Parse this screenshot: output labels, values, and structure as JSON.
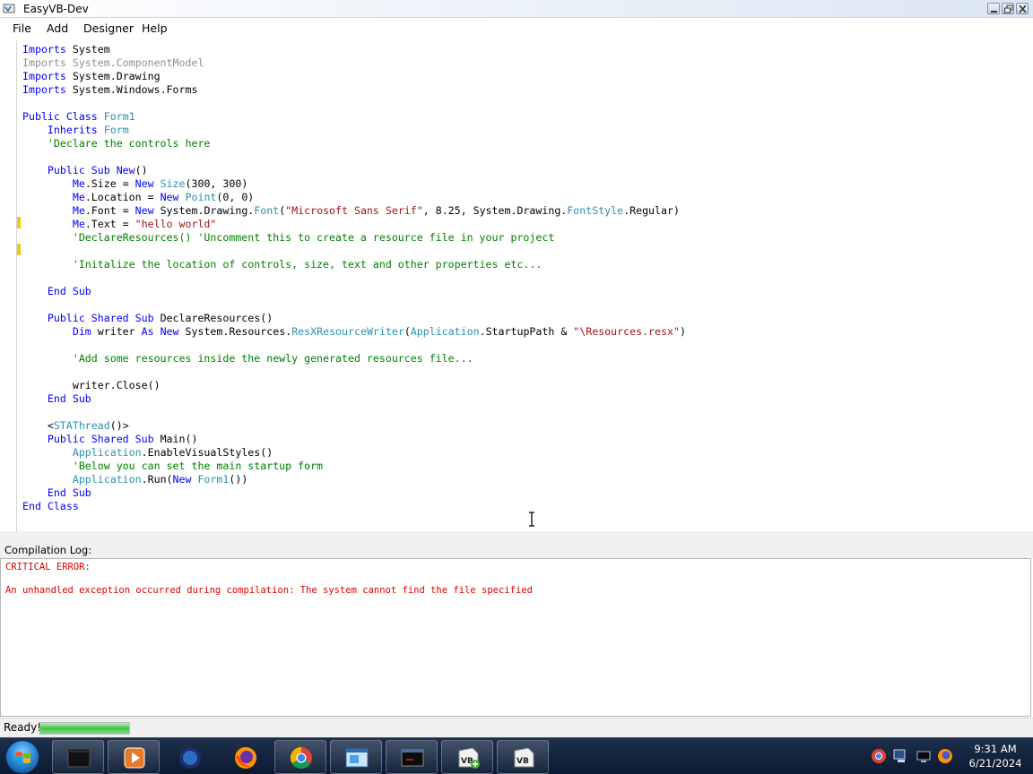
{
  "window": {
    "title": "EasyVB-Dev"
  },
  "menu": {
    "items": [
      "File",
      "Add",
      "Designer",
      "Help"
    ]
  },
  "editor": {
    "lines": [
      [
        {
          "t": "Imports",
          "c": "kw"
        },
        {
          "t": " System"
        }
      ],
      [
        {
          "t": "Imports System.ComponentModel",
          "c": "gray"
        }
      ],
      [
        {
          "t": "Imports",
          "c": "kw"
        },
        {
          "t": " System.Drawing"
        }
      ],
      [
        {
          "t": "Imports",
          "c": "kw"
        },
        {
          "t": " System.Windows.Forms"
        }
      ],
      [],
      [
        {
          "t": "Public Class ",
          "c": "kw"
        },
        {
          "t": "Form1",
          "c": "ty"
        }
      ],
      [
        {
          "t": "    Inherits ",
          "c": "kw"
        },
        {
          "t": "Form",
          "c": "ty"
        }
      ],
      [
        {
          "t": "    'Declare the controls here",
          "c": "cm"
        }
      ],
      [],
      [
        {
          "t": "    Public Sub New",
          "c": "kw"
        },
        {
          "t": "()"
        }
      ],
      [
        {
          "t": "        Me",
          "c": "kw"
        },
        {
          "t": ".Size = "
        },
        {
          "t": "New ",
          "c": "kw"
        },
        {
          "t": "Size",
          "c": "ty"
        },
        {
          "t": "(300, 300)"
        }
      ],
      [
        {
          "t": "        Me",
          "c": "kw"
        },
        {
          "t": ".Location = "
        },
        {
          "t": "New ",
          "c": "kw"
        },
        {
          "t": "Point",
          "c": "ty"
        },
        {
          "t": "(0, 0)"
        }
      ],
      [
        {
          "t": "        Me",
          "c": "kw"
        },
        {
          "t": ".Font = "
        },
        {
          "t": "New ",
          "c": "kw"
        },
        {
          "t": "System.Drawing."
        },
        {
          "t": "Font",
          "c": "ty"
        },
        {
          "t": "("
        },
        {
          "t": "\"Microsoft Sans Serif\"",
          "c": "str"
        },
        {
          "t": ", 8.25, System.Drawing."
        },
        {
          "t": "FontStyle",
          "c": "ty"
        },
        {
          "t": ".Regular)"
        }
      ],
      [
        {
          "t": "        Me",
          "c": "kw"
        },
        {
          "t": ".Text = "
        },
        {
          "t": "\"hello world\"",
          "c": "str"
        }
      ],
      [
        {
          "t": "        'DeclareResources() 'Uncomment this to create a resource file in your project",
          "c": "cm"
        }
      ],
      [],
      [
        {
          "t": "        'Initalize the location of controls, size, text and other properties etc...",
          "c": "cm"
        }
      ],
      [],
      [
        {
          "t": "    End Sub",
          "c": "kw"
        }
      ],
      [],
      [
        {
          "t": "    Public Shared Sub ",
          "c": "kw"
        },
        {
          "t": "DeclareResources()"
        }
      ],
      [
        {
          "t": "        Dim ",
          "c": "kw"
        },
        {
          "t": "writer "
        },
        {
          "t": "As New ",
          "c": "kw"
        },
        {
          "t": "System.Resources."
        },
        {
          "t": "ResXResourceWriter",
          "c": "ty"
        },
        {
          "t": "("
        },
        {
          "t": "Application",
          "c": "ty"
        },
        {
          "t": ".StartupPath & "
        },
        {
          "t": "\"\\Resources.resx\"",
          "c": "str"
        },
        {
          "t": ")"
        }
      ],
      [],
      [
        {
          "t": "        'Add some resources inside the newly generated resources file...",
          "c": "cm"
        }
      ],
      [],
      [
        {
          "t": "        writer.Close()"
        }
      ],
      [
        {
          "t": "    End Sub",
          "c": "kw"
        }
      ],
      [],
      [
        {
          "t": "    <"
        },
        {
          "t": "STAThread",
          "c": "ty"
        },
        {
          "t": "()>"
        }
      ],
      [
        {
          "t": "    Public Shared Sub ",
          "c": "kw"
        },
        {
          "t": "Main()"
        }
      ],
      [
        {
          "t": "        Application",
          "c": "ty"
        },
        {
          "t": ".EnableVisualStyles()"
        }
      ],
      [
        {
          "t": "        'Below you can set the main startup form",
          "c": "cm"
        }
      ],
      [
        {
          "t": "        Application",
          "c": "ty"
        },
        {
          "t": ".Run("
        },
        {
          "t": "New ",
          "c": "kw"
        },
        {
          "t": "Form1",
          "c": "ty"
        },
        {
          "t": "())"
        }
      ],
      [
        {
          "t": "    End Sub",
          "c": "kw"
        }
      ],
      [
        {
          "t": "End Class",
          "c": "kw"
        }
      ]
    ]
  },
  "log": {
    "label": "Compilation Log:",
    "lines": [
      "CRITICAL ERROR:",
      "",
      "An unhandled exception occurred during compilation: The system cannot find the file specified"
    ],
    "color": "#e00000"
  },
  "status": {
    "text": "Ready!",
    "progress_percent": 100
  },
  "taskbar": {
    "apps": [
      "terminal-icon",
      "media-player-icon",
      "firefox-icon",
      "chrome-icon",
      "explorer-window-icon",
      "command-prompt-icon",
      "vb-setup-icon",
      "vb-icon"
    ],
    "app_labels": {
      "vb-setup-icon": "VB",
      "vb-icon": "VB"
    },
    "tray": [
      "chrome-tray-icon",
      "network-tray-icon",
      "display-tray-icon",
      "firefox-tray-icon"
    ],
    "clock": {
      "time": "9:31 AM",
      "date": "6/21/2024"
    }
  },
  "colors": {
    "keyword": "#0000ff",
    "type": "#2b91af",
    "comment": "#008000",
    "string": "#a31515",
    "error": "#e00000"
  }
}
